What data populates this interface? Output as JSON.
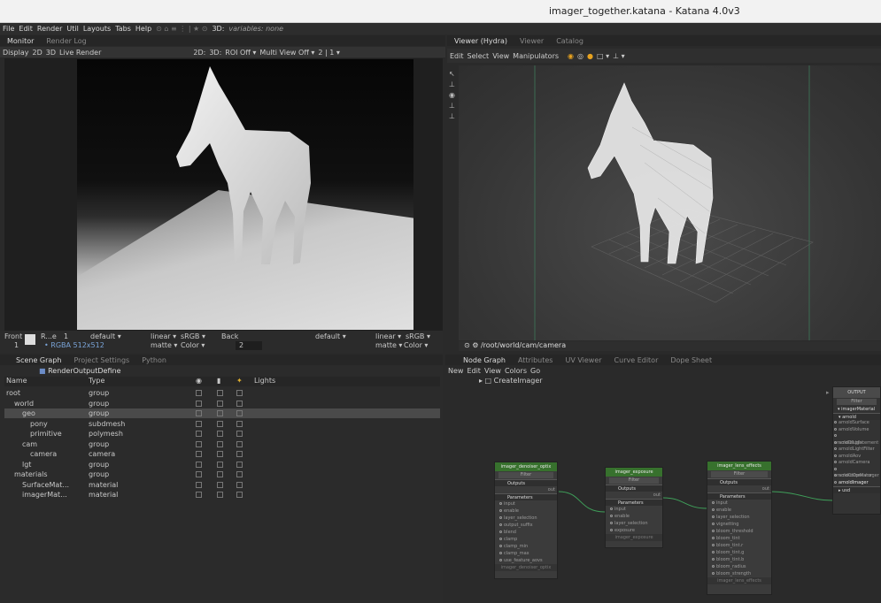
{
  "window_title": "imager_together.katana - Katana 4.0v3",
  "menubar": {
    "items": [
      "File",
      "Edit",
      "Render",
      "Util",
      "Layouts",
      "Tabs",
      "Help"
    ],
    "variables": "variables: none",
    "vp3d": "3D:"
  },
  "monitor": {
    "tabs": [
      "Monitor",
      "Render Log"
    ],
    "toolbar": [
      "Display",
      "2D",
      "3D",
      "Live Render"
    ],
    "toolbar_right": [
      "2D:",
      "3D:",
      "ROI Off ▾",
      "Multi View Off ▾",
      "2 | 1 ▾"
    ],
    "footer": {
      "view": "Front",
      "frame": "1",
      "name": "R...e",
      "num": "1",
      "lut": "default ▾",
      "linear": "linear ▾",
      "srgb": "sRGB ▾",
      "back": "Back",
      "default2": "default ▾",
      "linear2": "linear ▾",
      "srgb2": "sRGB ▾",
      "format": "• RGBA 512x512",
      "matte": "matte ▾",
      "color": "Color ▾",
      "back_val": "2",
      "matte2": "matte ▾",
      "color2": "Color ▾"
    }
  },
  "viewer": {
    "tabs": [
      "Viewer (Hydra)",
      "Viewer",
      "Catalog"
    ],
    "toolbar": [
      "Edit",
      "Select",
      "View",
      "Manipulators"
    ],
    "camera_path": "/root/world/cam/camera"
  },
  "scenegraph": {
    "tabs": [
      "Scene Graph",
      "Project Settings",
      "Python"
    ],
    "node": "RenderOutputDefine",
    "headers": {
      "name": "Name",
      "type": "Type",
      "lights": "Lights"
    },
    "rows": [
      {
        "name": "root",
        "type": "group",
        "indent": 0
      },
      {
        "name": "world",
        "type": "group",
        "indent": 1
      },
      {
        "name": "geo",
        "type": "group",
        "indent": 2
      },
      {
        "name": "pony",
        "type": "subdmesh",
        "indent": 3
      },
      {
        "name": "primitive",
        "type": "polymesh",
        "indent": 3
      },
      {
        "name": "cam",
        "type": "group",
        "indent": 2
      },
      {
        "name": "camera",
        "type": "camera",
        "indent": 3
      },
      {
        "name": "lgt",
        "type": "group",
        "indent": 2
      },
      {
        "name": "materials",
        "type": "group",
        "indent": 1
      },
      {
        "name": "SurfaceMat...",
        "type": "material",
        "indent": 2
      },
      {
        "name": "imagerMat...",
        "type": "material",
        "indent": 2
      }
    ]
  },
  "nodegraph": {
    "tabs": [
      "Node Graph",
      "Attributes",
      "UV Viewer",
      "Curve Editor",
      "Dope Sheet"
    ],
    "menu": [
      "New",
      "Edit",
      "View",
      "Colors",
      "Go"
    ],
    "breadcrumb": "CreateImager",
    "nodes": [
      {
        "title": "imager_denoiser_optix",
        "filter": "Filter",
        "outputs": "Outputs",
        "out": "out",
        "params": [
          "input",
          "enable",
          "layer_selection",
          "output_suffix",
          "blend",
          "clamp",
          "clamp_min",
          "clamp_max",
          "use_feature_aovs"
        ],
        "footer": "imager_denoiser_optix"
      },
      {
        "title": "imager_exposure",
        "filter": "Filter",
        "outputs": "Outputs",
        "out": "out",
        "params": [
          "input",
          "enable",
          "layer_selection",
          "exposure"
        ],
        "footer": "imager_exposure"
      },
      {
        "title": "imager_lens_effects",
        "filter": "Filter",
        "outputs": "Outputs",
        "out": "out",
        "params": [
          "input",
          "enable",
          "layer_selection",
          "vignetting",
          "bloom_threshold",
          "bloom_tint",
          "bloom_tint.r",
          "bloom_tint.g",
          "bloom_tint.b",
          "bloom_radius",
          "bloom_strength"
        ],
        "footer": "imager_lens_effects"
      }
    ],
    "section_params": "Parameters",
    "output_node": {
      "title": "OUTPUT",
      "filter": "Filter",
      "material": "imagerMaterial",
      "arnold": "arnold",
      "ports": [
        "arnoldSurface",
        "arnoldVolume",
        "arnoldDisplacement",
        "arnoldLight",
        "arnoldLightFilter",
        "arnoldAov",
        "arnoldCamera",
        "arnoldColorManager",
        "arnoldOperator",
        "arnoldImager"
      ],
      "usd": "usd"
    }
  }
}
